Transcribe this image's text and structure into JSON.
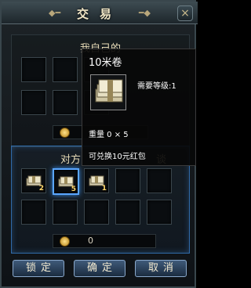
{
  "window": {
    "title": "交易",
    "close_glyph": "×"
  },
  "my_section": {
    "label": "我自己的",
    "money": ""
  },
  "other_section": {
    "label": "对方",
    "label_tail": "谈",
    "money": "0",
    "items": [
      {
        "slot": 0,
        "icon": "cash-bundle-icon",
        "qty": "2"
      },
      {
        "slot": 1,
        "icon": "cash-bundle-icon",
        "qty": "5",
        "selected": true
      },
      {
        "slot": 2,
        "icon": "cash-bundle-icon",
        "qty": "1"
      }
    ]
  },
  "buttons": {
    "lock": "锁定",
    "confirm": "确定",
    "cancel": "取消"
  },
  "tooltip": {
    "name": "10米卷",
    "level_requirement": "需要等级:1",
    "weight": "重量 0 × 5",
    "description": "可兑换10元红包"
  },
  "colors": {
    "accent_blue": "#5aa6ff",
    "gold": "#ffd76b",
    "panel_bg": "#1d2327"
  }
}
